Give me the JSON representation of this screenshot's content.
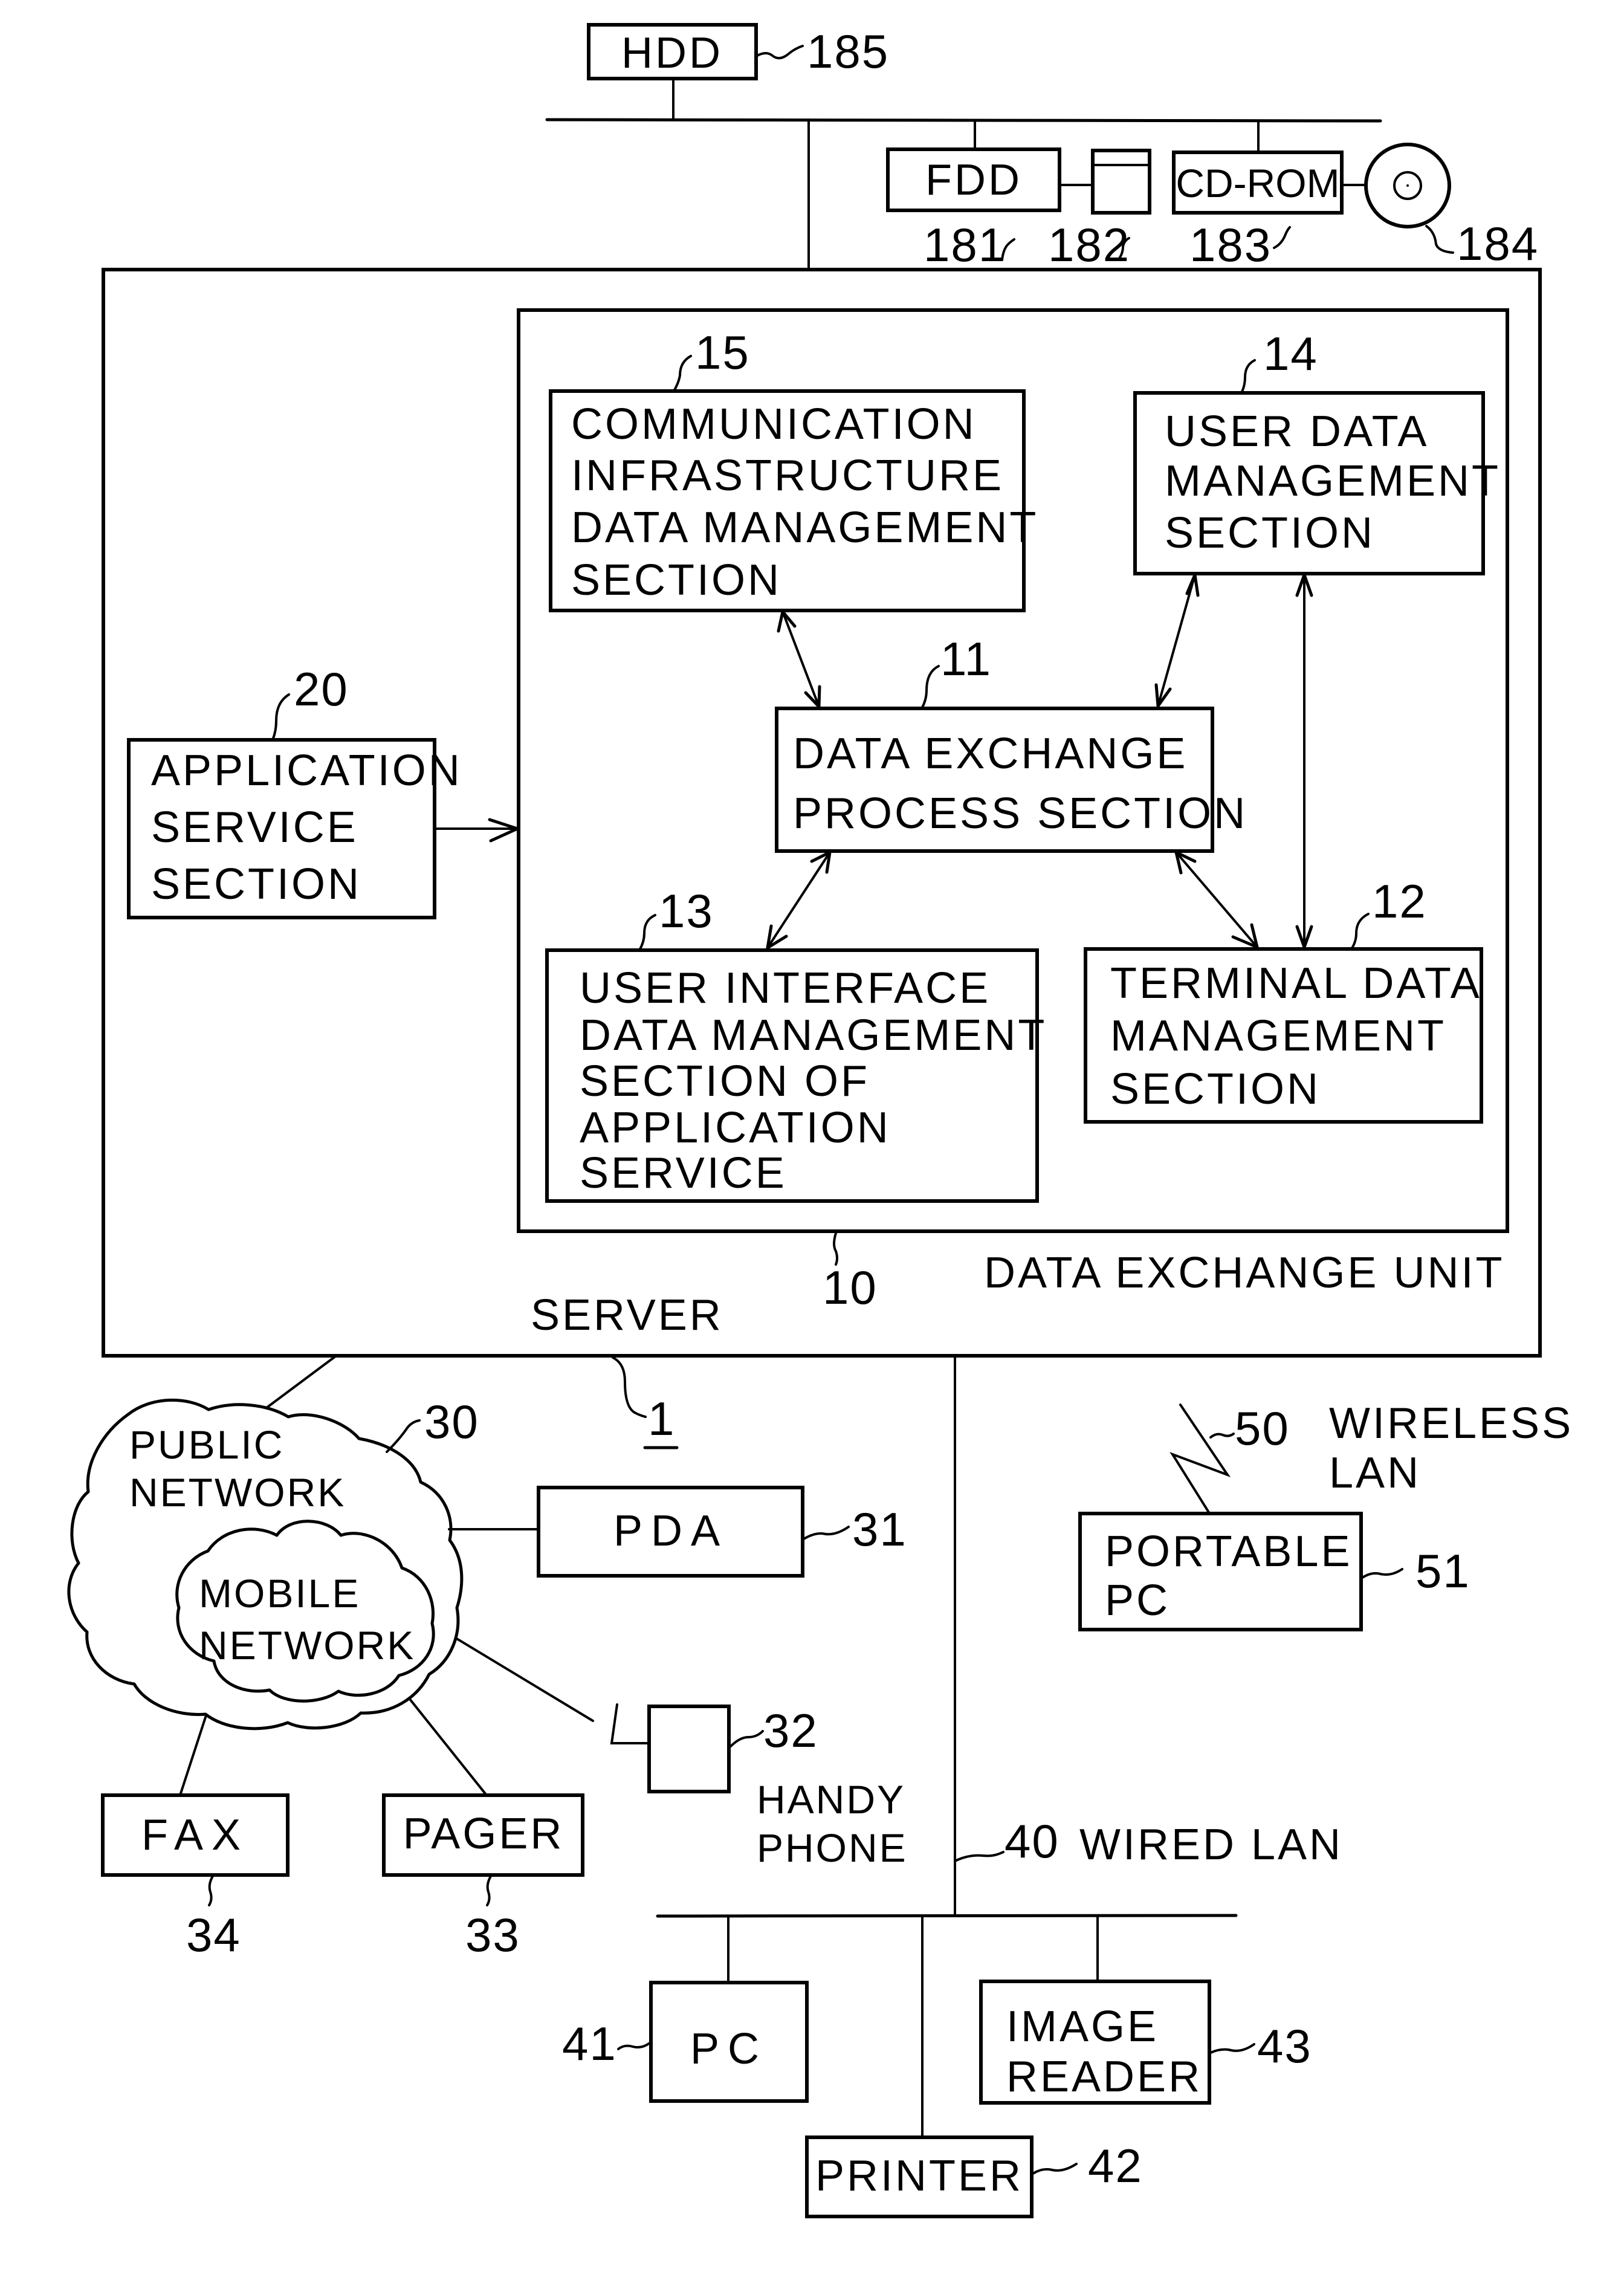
{
  "figure": {
    "server": {
      "ref": "1",
      "label": "SERVER"
    },
    "data_exchange_unit": {
      "ref": "10",
      "label": "DATA EXCHANGE UNIT"
    },
    "sections": {
      "data_exchange_process": {
        "ref": "11",
        "lines": [
          "DATA EXCHANGE",
          "PROCESS SECTION"
        ]
      },
      "terminal_data_mgmt": {
        "ref": "12",
        "lines": [
          "TERMINAL DATA",
          "MANAGEMENT",
          "SECTION"
        ]
      },
      "ui_data_mgmt": {
        "ref": "13",
        "lines": [
          "USER INTERFACE",
          "DATA MANAGEMENT",
          "SECTION OF",
          "APPLICATION",
          "SERVICE"
        ]
      },
      "user_data_mgmt": {
        "ref": "14",
        "lines": [
          "USER DATA",
          "MANAGEMENT",
          "SECTION"
        ]
      },
      "comm_infra_data_mgmt": {
        "ref": "15",
        "lines": [
          "COMMUNICATION",
          "INFRASTRUCTURE",
          "DATA MANAGEMENT",
          "SECTION"
        ]
      },
      "application_service": {
        "ref": "20",
        "lines": [
          "APPLICATION",
          "SERVICE",
          "SECTION"
        ]
      }
    },
    "storage": {
      "hdd": {
        "ref": "185",
        "label": "HDD"
      },
      "fdd": {
        "ref": "181",
        "label": "FDD"
      },
      "floppy": {
        "ref": "182"
      },
      "cdrom": {
        "ref": "183",
        "label": "CD-ROM"
      },
      "disc": {
        "ref": "184"
      }
    },
    "public_network": {
      "ref": "30",
      "lines": [
        "PUBLIC",
        "NETWORK"
      ],
      "mobile_lines": [
        "MOBILE",
        "NETWORK"
      ],
      "devices": {
        "pda": {
          "ref": "31",
          "label": "PDA"
        },
        "handy_phone": {
          "ref": "32",
          "lines": [
            "HANDY",
            "PHONE"
          ]
        },
        "pager": {
          "ref": "33",
          "label": "PAGER"
        },
        "fax": {
          "ref": "34",
          "label": "FAX"
        }
      }
    },
    "wired_lan": {
      "ref": "40",
      "label": "WIRED LAN",
      "devices": {
        "pc": {
          "ref": "41",
          "label": "PC"
        },
        "printer": {
          "ref": "42",
          "label": "PRINTER"
        },
        "image_reader": {
          "ref": "43",
          "lines": [
            "IMAGE",
            "READER"
          ]
        }
      }
    },
    "wireless_lan": {
      "ref": "50",
      "lines": [
        "WIRELESS",
        "LAN"
      ],
      "devices": {
        "portable_pc": {
          "ref": "51",
          "lines": [
            "PORTABLE",
            "PC"
          ]
        }
      }
    }
  }
}
